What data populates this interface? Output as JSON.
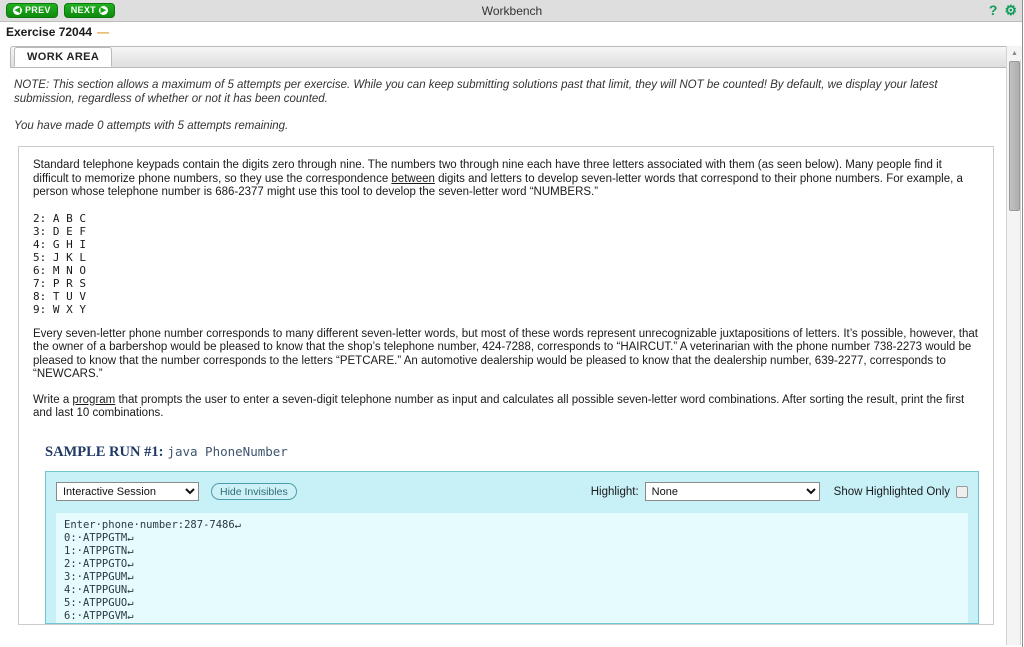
{
  "topbar": {
    "prev_label": "PREV",
    "next_label": "NEXT",
    "prev_icon": "circle-arrow-left-icon",
    "next_icon": "circle-arrow-right-icon",
    "title": "Workbench",
    "help_icon": "?",
    "gear_icon": "⚙",
    "accent_green": "#18a018",
    "icon_green": "#0f9d58",
    "background": "#dedede"
  },
  "exercise": {
    "label": "Exercise 72044",
    "dash": "—",
    "dash_color": "#e0a040"
  },
  "tabs": [
    {
      "label": "WORK AREA",
      "active": true
    }
  ],
  "note": {
    "paragraph1": "NOTE: This section allows a maximum of 5 attempts per exercise. While you can keep submitting solutions past that limit, they will NOT be counted! By default, we display your latest submission, regardless of whether or not it has been counted.",
    "paragraph2": "You have made 0 attempts with 5 attempts remaining."
  },
  "problem": {
    "intro_a": "Standard telephone keypads contain the digits zero through nine. The numbers two through nine each have three letters associated with them (as seen below). Many people find it difficult to memorize phone numbers, so they use the correspondence ",
    "intro_link": "between",
    "intro_b": " digits and letters to develop seven-letter words that correspond to their phone numbers. For example, a person whose telephone number is 686-2377 might use this tool to develop the seven-letter word “NUMBERS.”",
    "keypad": "2: A B C\n3: D E F\n4: G H I\n5: J K L\n6: M N O\n7: P R S\n8: T U V\n9: W X Y",
    "paragraph2": "Every seven-letter phone number corresponds to many different seven-letter words, but most of these words represent unrecognizable juxtapositions of letters. It’s possible, however, that the owner of a barbershop would be pleased to know that the shop’s telephone number, 424-7288, corresponds to “HAIRCUT.” A veterinarian with the phone number 738-2273 would be pleased to know that the number corresponds to the letters “PETCARE.” An automotive dealership would be pleased to know that the dealership number, 639-2277, corresponds to “NEWCARS.”",
    "task_a": "Write a ",
    "task_link": "program",
    "task_b": " that prompts the user to enter a seven-digit telephone number as input and calculates all possible seven-letter word combinations. After sorting the result, print the first and last 10 combinations."
  },
  "sample_run": {
    "label": "SAMPLE RUN #1:",
    "command": "java PhoneNumber",
    "label_color": "#1f3864"
  },
  "console": {
    "session_select": {
      "value": "Interactive Session",
      "options": [
        "Interactive Session"
      ]
    },
    "hide_invisibles_label": "Hide Invisibles",
    "highlight_label": "Highlight:",
    "highlight_select": {
      "value": "None",
      "options": [
        "None"
      ]
    },
    "show_highlighted_only_label": "Show Highlighted Only",
    "show_highlighted_only_checked": false,
    "panel_color": "#c8f0f7",
    "terminal_color": "#e6fbfd",
    "terminal_text": "Enter·phone·number:287-7486↵\n0:·ATPPGTM↵\n1:·ATPPGTN↵\n2:·ATPPGTO↵\n3:·ATPPGUM↵\n4:·ATPPGUN↵\n5:·ATPPGUO↵\n6:·ATPPGVM↵"
  },
  "scrollbar": {
    "up_arrow": "▲",
    "thumb_position": "top"
  }
}
